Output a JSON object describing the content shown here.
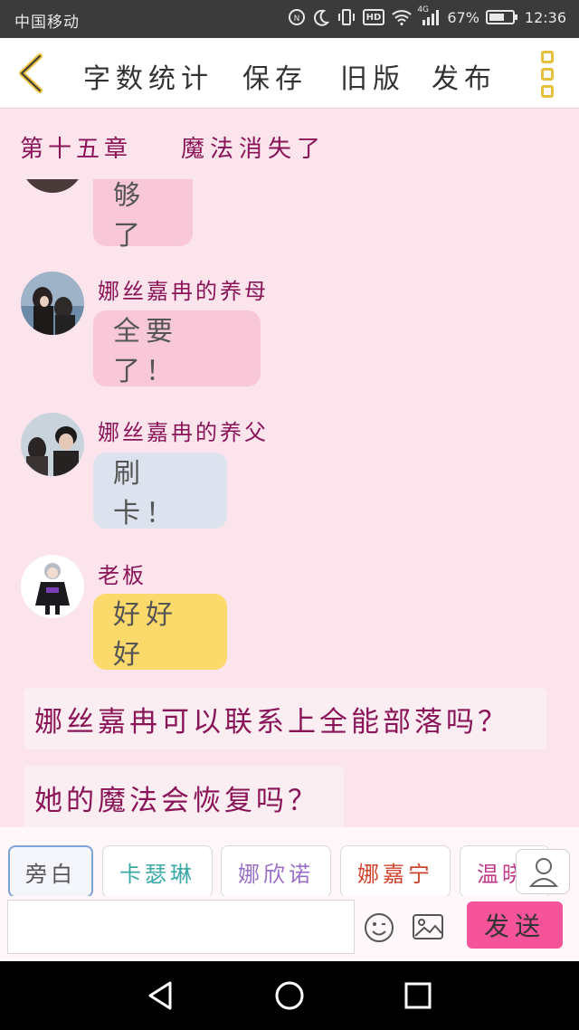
{
  "status_bar": {
    "carrier": "中国移动",
    "network": "4G",
    "battery_percent": "67%",
    "battery_level": 0.67,
    "time": "12:36",
    "hd_label": "HD",
    "icons": [
      "nfc-icon",
      "moon-icon",
      "vibrate-icon",
      "hd-icon",
      "wifi-icon",
      "signal-icon",
      "battery-icon"
    ]
  },
  "toolbar": {
    "back_icon": "chevron-left-icon",
    "word_count": "字数统计",
    "save": "保存",
    "old_version": "旧版",
    "publish": "发布",
    "more_icon": "more-vertical-icon",
    "accent_color": "#e6c03d"
  },
  "chapter": {
    "number": "第十五章",
    "title": "魔法消失了"
  },
  "messages": [
    {
      "sender": "",
      "text": "够了",
      "bubble_color": "#f9c8d8"
    },
    {
      "sender": "娜丝嘉冉的养母",
      "text": "全要了！",
      "bubble_color": "#f9c8d8"
    },
    {
      "sender": "娜丝嘉冉的养父",
      "text": "刷卡！",
      "bubble_color": "#dde3ee"
    },
    {
      "sender": "老板",
      "text": "好好好",
      "bubble_color": "#fbd96a"
    }
  ],
  "narrations": [
    "娜丝嘉冉可以联系上全能部落吗？",
    "她的魔法会恢复吗？"
  ],
  "roles": [
    {
      "label": "旁白",
      "color": "#555555",
      "active": true
    },
    {
      "label": "卡瑟琳",
      "color": "#3aa9a6",
      "active": false
    },
    {
      "label": "娜欣诺",
      "color": "#9b6fc8",
      "active": false
    },
    {
      "label": "娜嘉宁",
      "color": "#d0432e",
      "active": false
    },
    {
      "label": "温晓",
      "color": "#c0398a",
      "active": false
    }
  ],
  "input": {
    "value": "",
    "placeholder": "",
    "send_label": "发送",
    "send_color": "#f6549a"
  }
}
